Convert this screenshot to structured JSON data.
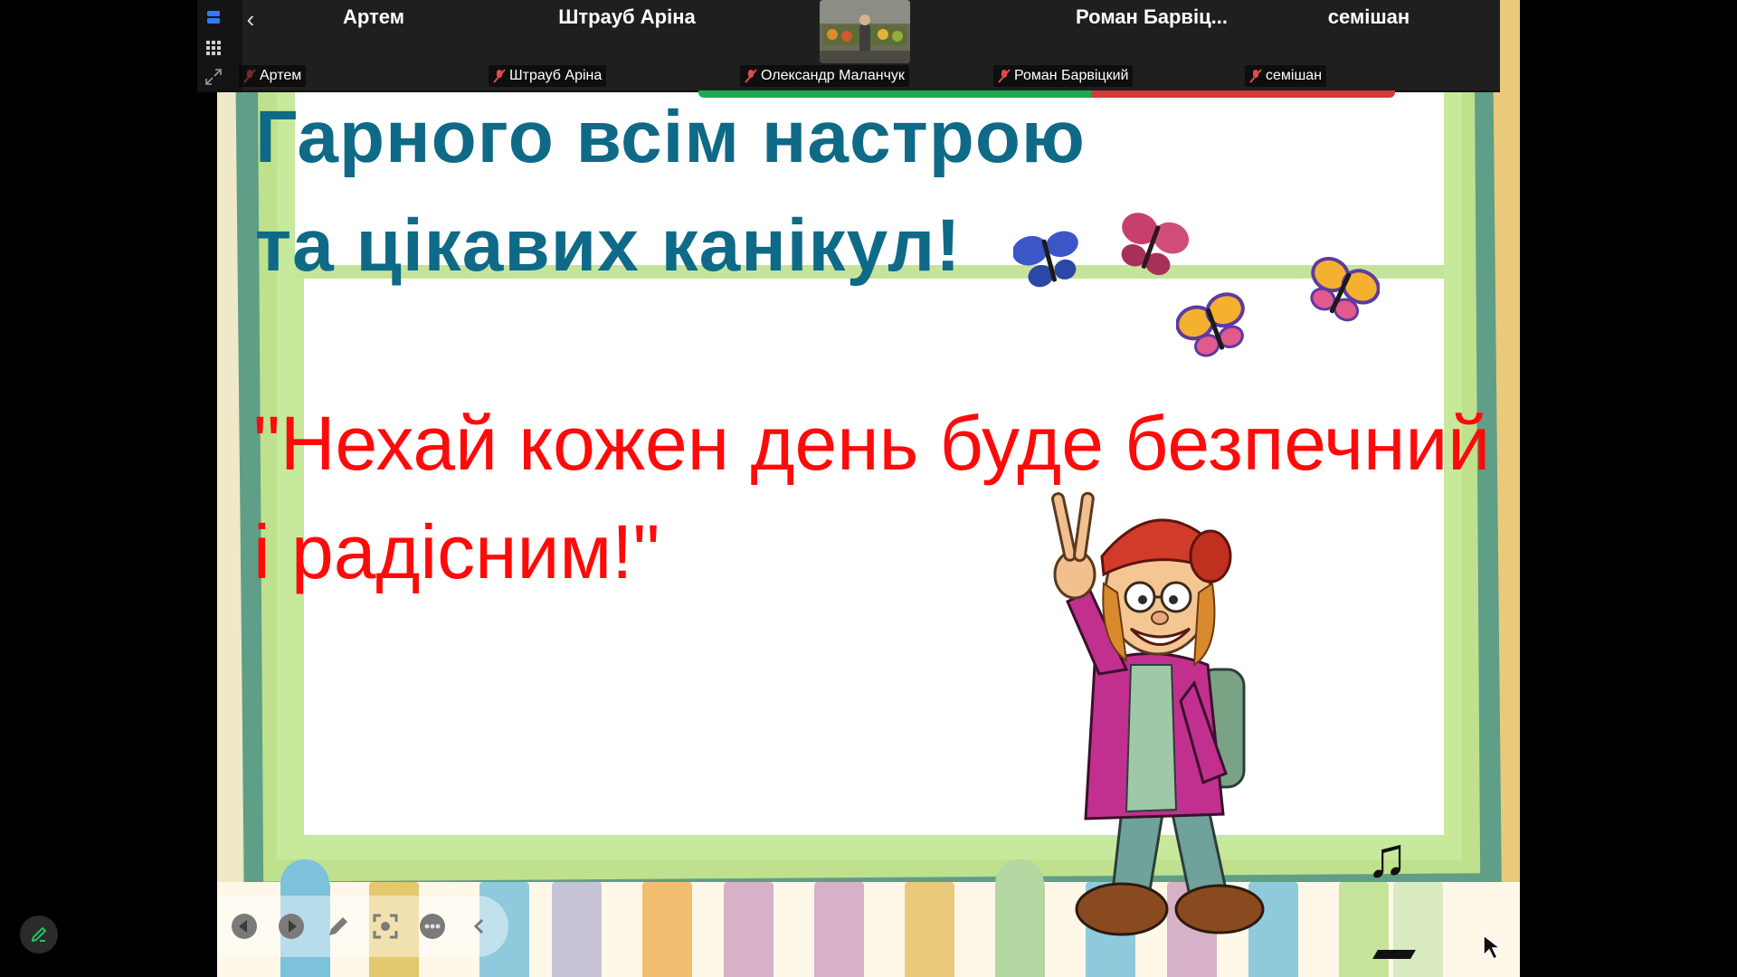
{
  "participants": [
    {
      "name": "Артем",
      "label": "Артем"
    },
    {
      "name": "Штрауб Аріна",
      "label": "Штрауб Аріна"
    },
    {
      "name": "",
      "label": "Олександр Маланчук"
    },
    {
      "name": "Роман  Барвіц...",
      "label": "Роман Барвіцкий"
    },
    {
      "name": "семішан",
      "label": "семішан"
    }
  ],
  "slide": {
    "heading": "Гарного всім настрою\nта цікавих  канікул!",
    "quote": "\"Нехай кожен день буде безпечний\n   і радісним!\""
  },
  "icons": {
    "speaker_view": "speaker-view-icon",
    "gallery_view": "gallery-view-icon",
    "expand": "expand-icon",
    "back": "chevron-left-icon",
    "mute": "microphone-muted-icon",
    "prev": "previous-slide-icon",
    "next": "next-slide-icon",
    "pen": "pen-icon",
    "pointer": "laser-pointer-icon",
    "more": "more-options-icon",
    "collapse": "chevron-left-icon",
    "annotate": "annotate-pen-icon",
    "music": "music-note-icon",
    "cursor": "cursor-icon"
  },
  "colors": {
    "heading": "#0e6a86",
    "quote": "#ff0a0a",
    "talk_active": "#1fa850",
    "talk_alert": "#d33a3a",
    "mute": "#e04a4a",
    "toolbar_bg": "#1f1f1f",
    "frame_green": "#5f9e87",
    "frame_light": "#bfe08d"
  }
}
